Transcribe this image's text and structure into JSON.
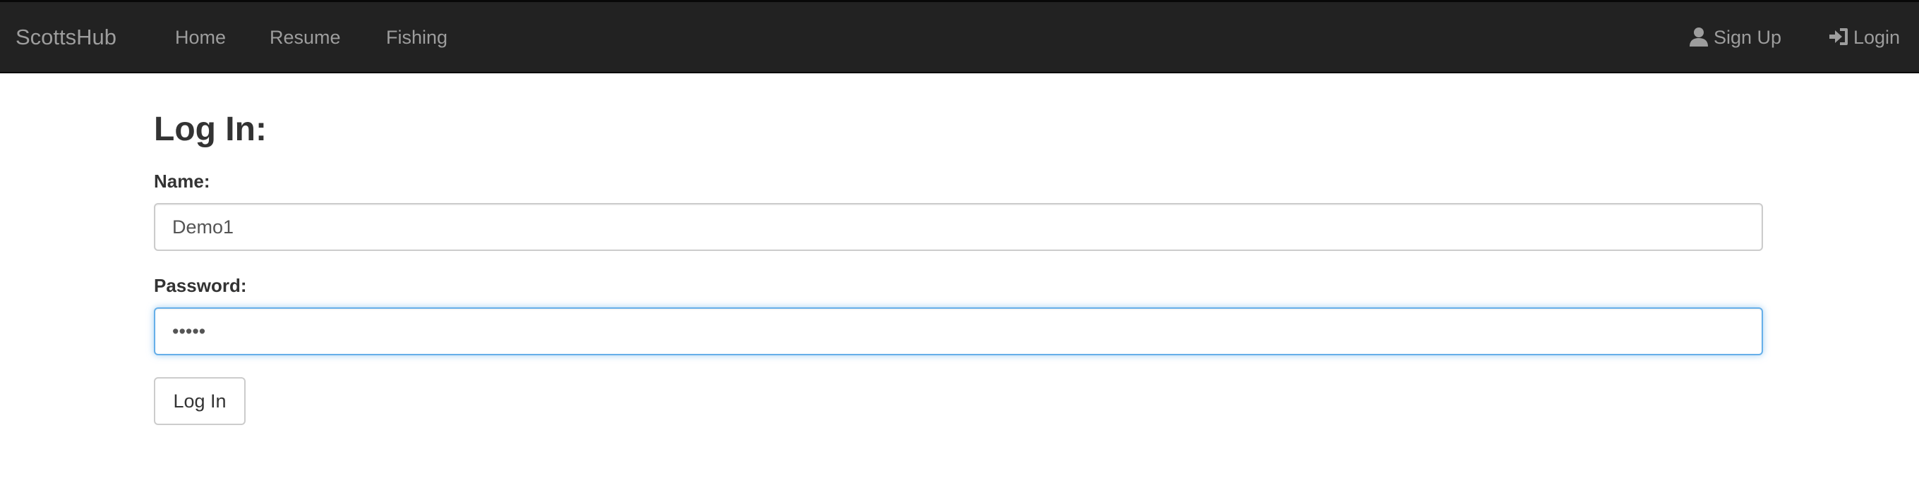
{
  "navbar": {
    "brand": "ScottsHub",
    "links": [
      {
        "label": "Home"
      },
      {
        "label": "Resume"
      },
      {
        "label": "Fishing"
      }
    ],
    "right_links": [
      {
        "label": "Sign Up",
        "icon": "user-icon"
      },
      {
        "label": "Login",
        "icon": "log-in-icon"
      }
    ],
    "background": "#222222",
    "link_color": "#9d9d9d"
  },
  "form": {
    "title": "Log In:",
    "name_label": "Name:",
    "name_value": "Demo1",
    "password_label": "Password:",
    "password_value": "•••••",
    "submit_label": "Log In",
    "focus_color": "#66afe9"
  }
}
